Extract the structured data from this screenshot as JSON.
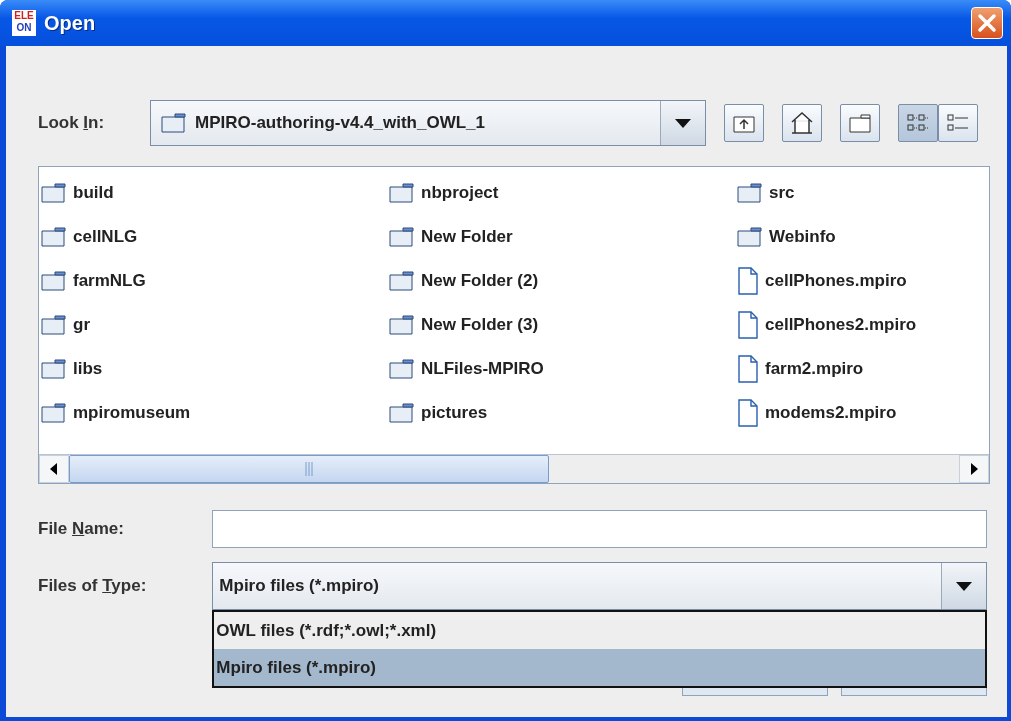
{
  "window": {
    "title": "Open",
    "app_icon": {
      "top": "ELE",
      "bottom": "ON"
    }
  },
  "look_in": {
    "label": {
      "before": "Look ",
      "key": "I",
      "after": "n:"
    },
    "value": "MPIRO-authoring-v4.4_with_OWL_1"
  },
  "view_buttons": [
    {
      "kind": "list",
      "selected": true
    },
    {
      "kind": "details",
      "selected": false
    }
  ],
  "files": [
    {
      "name": "build",
      "kind": "folder"
    },
    {
      "name": "cellNLG",
      "kind": "folder"
    },
    {
      "name": "farmNLG",
      "kind": "folder"
    },
    {
      "name": "gr",
      "kind": "folder"
    },
    {
      "name": "libs",
      "kind": "folder"
    },
    {
      "name": "mpiromuseum",
      "kind": "folder"
    },
    {
      "name": "nbproject",
      "kind": "folder"
    },
    {
      "name": "New Folder",
      "kind": "folder"
    },
    {
      "name": "New Folder (2)",
      "kind": "folder"
    },
    {
      "name": "New Folder (3)",
      "kind": "folder"
    },
    {
      "name": "NLFiles-MPIRO",
      "kind": "folder"
    },
    {
      "name": "pictures",
      "kind": "folder"
    },
    {
      "name": "src",
      "kind": "folder"
    },
    {
      "name": "Webinfo",
      "kind": "folder"
    },
    {
      "name": "cellPhones.mpiro",
      "kind": "file"
    },
    {
      "name": "cellPhones2.mpiro",
      "kind": "file"
    },
    {
      "name": "farm2.mpiro",
      "kind": "file"
    },
    {
      "name": "modems2.mpiro",
      "kind": "file"
    }
  ],
  "file_name": {
    "label": {
      "before": "File ",
      "key": "N",
      "after": "ame:"
    }
  },
  "files_of_type": {
    "label": {
      "before": "Files of ",
      "key": "T",
      "after": "ype:"
    },
    "value": "Mpiro files (*.mpiro)",
    "options": [
      {
        "label": "OWL files (*.rdf;*.owl;*.xml)",
        "selected": false
      },
      {
        "label": "Mpiro files (*.mpiro)",
        "selected": true
      }
    ]
  }
}
